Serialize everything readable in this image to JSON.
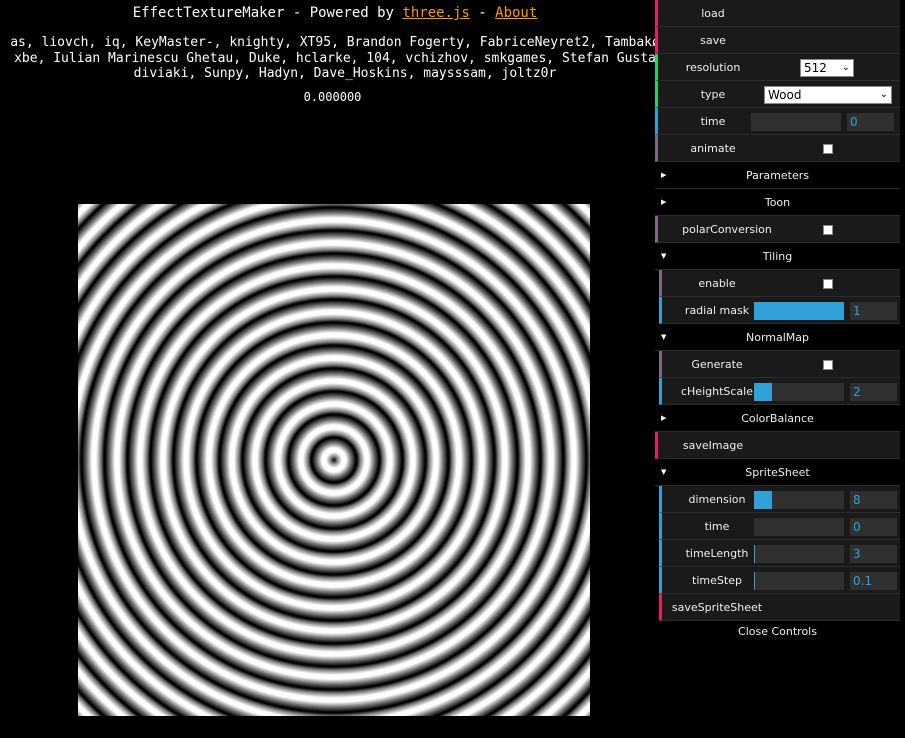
{
  "header": {
    "title_prefix": "EffectTextureMaker - Powered by ",
    "threejs_link": "three.js",
    "separator": " - ",
    "about_link": "About",
    "credits_line1": "as, liovch, iq, KeyMaster-, knighty, XT95, Brandon Fogerty, FabriceNeyret2, Tambakø",
    "credits_line2": "xbe, Iulian Marinescu Ghetau, Duke, hclarke, 104, vchizhov, smkgames, Stefan Gusta",
    "credits_line3": "diviaki, Sunpy, Hadyn, Dave_Hoskins, maysssam, joltz0r",
    "timer": "0.000000"
  },
  "colors": {
    "link": "#ff9900",
    "slider_fill": "#2fa1d6",
    "function_marker": "#e61d5f",
    "boolean_marker": "#806787",
    "number_marker": "#2fa1d6",
    "option_marker": "#1ed36f"
  },
  "gui": {
    "load": "load",
    "save": "save",
    "resolution_label": "resolution",
    "resolution_value": "512",
    "type_label": "type",
    "type_value": "Wood",
    "time_label": "time",
    "time_value": "0",
    "time_level": 0,
    "animate_label": "animate",
    "animate_checked": false,
    "folder_parameters": "Parameters",
    "folder_toon": "Toon",
    "polar_label": "polarConversion",
    "polar_checked": false,
    "folder_tiling": "Tiling",
    "enable_label": "enable",
    "enable_checked": false,
    "radial_mask_label": "radial mask",
    "radial_mask_value": "1",
    "radial_mask_level": 1.0,
    "folder_normalmap": "NormalMap",
    "generate_label": "Generate",
    "generate_checked": false,
    "heightscale_label": "cHeightScale",
    "heightscale_value": "2",
    "heightscale_level": 0.2,
    "folder_colorbalance": "ColorBalance",
    "saveimage": "saveImage",
    "folder_spritesheet": "SpriteSheet",
    "dimension_label": "dimension",
    "dimension_value": "8",
    "dimension_level": 0.2,
    "ss_time_label": "time",
    "ss_time_value": "0",
    "ss_time_level": 0,
    "timelength_label": "timeLength",
    "timelength_value": "3",
    "timelength_level": 0.01,
    "timestep_label": "timeStep",
    "timestep_value": "0.1",
    "timestep_level": 0.01,
    "savespritesheet": "saveSpriteSheet",
    "close_controls": "Close Controls"
  },
  "icons": {
    "folder_closed": "triangle-right",
    "folder_open": "triangle-down"
  }
}
